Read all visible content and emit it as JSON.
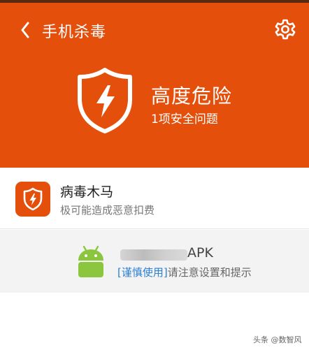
{
  "header": {
    "title": "手机杀毒",
    "status_title": "高度危险",
    "status_subtitle": "1项安全问题",
    "background_color": "#e4500c"
  },
  "icons": {
    "back": "chevron-left-icon",
    "settings": "gear-icon",
    "status": "shield-lightning-icon",
    "threat": "shield-lightning-icon",
    "app": "android-icon"
  },
  "threat": {
    "title": "病毒木马",
    "description": "极可能造成恶意扣费"
  },
  "app_item": {
    "name_suffix": "APK",
    "tag": "[谨慎使用]",
    "description": "请注意设置和提示",
    "tag_color": "#2b7fd4"
  },
  "watermark": "头条 @数智风"
}
